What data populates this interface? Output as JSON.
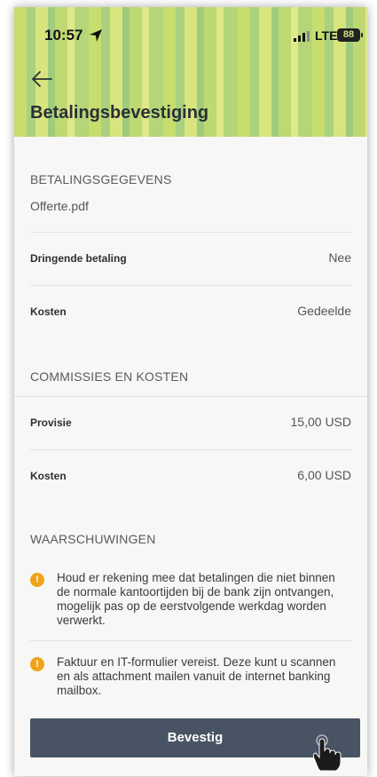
{
  "status_bar": {
    "time": "10:57",
    "network": "LTE",
    "battery": "88"
  },
  "header": {
    "back_icon": "arrow-left-icon",
    "title": "Betalingsbevestiging"
  },
  "payment_details": {
    "section_title": "BETALINGSGEGEVENS",
    "file_name": "Offerte.pdf",
    "rows": [
      {
        "label": "Dringende betaling",
        "value": "Nee"
      },
      {
        "label": "Kosten",
        "value": "Gedeelde"
      }
    ]
  },
  "commissions": {
    "section_title": "COMMISSIES EN KOSTEN",
    "rows": [
      {
        "label": "Provisie",
        "value": "15,00 USD"
      },
      {
        "label": "Kosten",
        "value": "6,00 USD"
      }
    ]
  },
  "warnings": {
    "section_title": "WAARSCHUWINGEN",
    "icon": "warning-icon",
    "items": [
      "Houd er rekening mee dat betalingen die niet binnen de normale kantoortijden bij de bank zijn ontvangen, mogelijk pas op de eerstvolgende werkdag worden verwerkt.",
      "Faktuur en IT-formulier vereist. Deze kunt u scannen en als attachment mailen vanuit de internet banking mailbox."
    ]
  },
  "confirm_button": {
    "label": "Bevestig"
  },
  "colors": {
    "button": "#485463",
    "warning": "#f0a31a",
    "header_green": "#c7dd6e"
  }
}
